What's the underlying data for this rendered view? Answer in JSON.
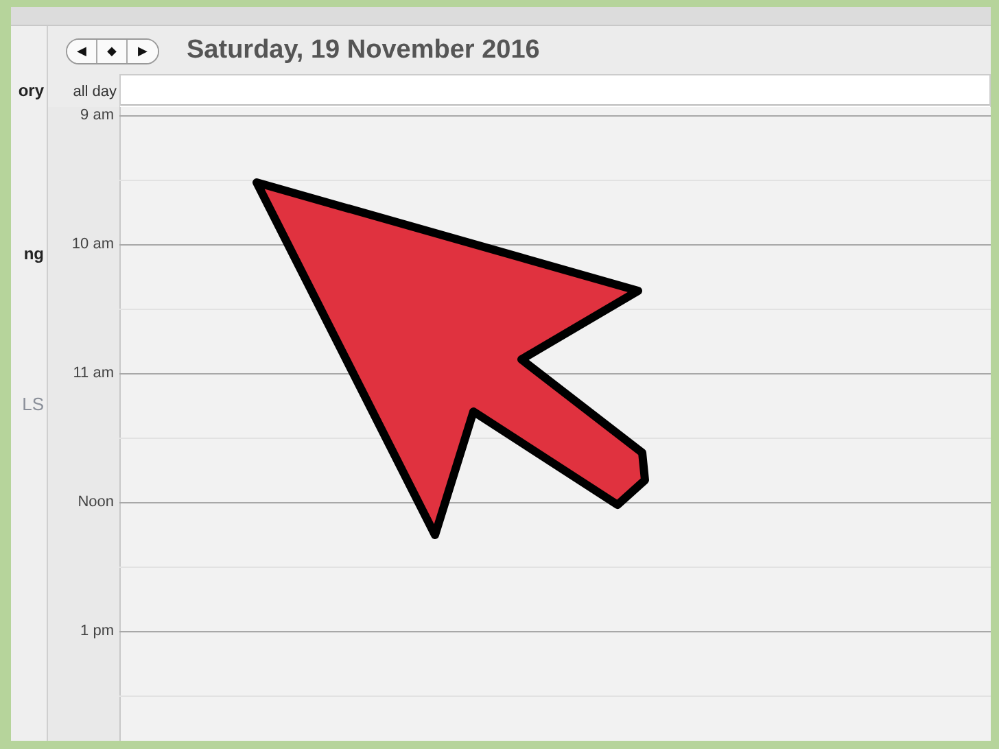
{
  "sidebar": {
    "items": [
      {
        "label": "ory",
        "kind": "bold"
      },
      {
        "label": "ng",
        "kind": "bold"
      },
      {
        "label": "LS",
        "kind": "header"
      }
    ]
  },
  "navigation": {
    "buttons": [
      "◀",
      "◆",
      "▶"
    ]
  },
  "header": {
    "date": "Saturday, 19 November 2016"
  },
  "all_day": {
    "label": "all day"
  },
  "hours": [
    "9 am",
    "10 am",
    "11 am",
    "Noon",
    "1 pm"
  ]
}
